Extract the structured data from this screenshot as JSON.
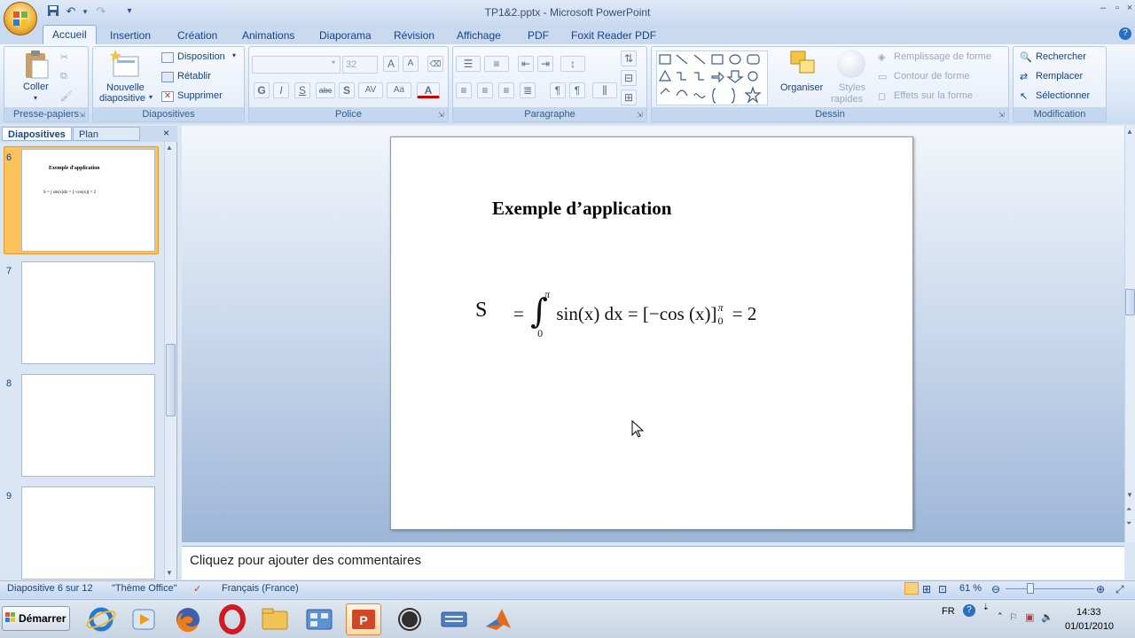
{
  "window": {
    "title": "TP1&2.pptx - Microsoft PowerPoint"
  },
  "tabs": [
    "Accueil",
    "Insertion",
    "Création",
    "Animations",
    "Diaporama",
    "Révision",
    "Affichage",
    "PDF",
    "Foxit Reader PDF"
  ],
  "ribbon": {
    "clipboard": {
      "paste": "Coller",
      "group": "Presse-papiers"
    },
    "slides": {
      "new_slide_1": "Nouvelle",
      "new_slide_2": "diapositive",
      "layout": "Disposition",
      "reset": "Rétablir",
      "delete": "Supprimer",
      "group": "Diapositives"
    },
    "font": {
      "size": "32",
      "group": "Police",
      "bold": "G",
      "italic": "I",
      "underline": "S",
      "strike": "abc",
      "shadow": "S",
      "spacing": "AV",
      "case": "Aa",
      "color": "A"
    },
    "paragraph": {
      "group": "Paragraphe"
    },
    "drawing": {
      "arrange": "Organiser",
      "styles_1": "Styles",
      "styles_2": "rapides",
      "fill": "Remplissage de forme",
      "outline": "Contour de forme",
      "effects": "Effets sur la forme",
      "group": "Dessin"
    },
    "editing": {
      "find": "Rechercher",
      "replace": "Remplacer",
      "select": "Sélectionner",
      "group": "Modification"
    }
  },
  "panel": {
    "tab_slides": "Diapositives",
    "tab_outline": "Plan",
    "thumbs": [
      {
        "num": "6",
        "title": "Exemple d'application",
        "eq": "S = ∫ sin(x)dx = [−cos(x)] = 2"
      },
      {
        "num": "7"
      },
      {
        "num": "8"
      },
      {
        "num": "9"
      }
    ]
  },
  "slide": {
    "title": "Exemple d’application",
    "s_label": "S",
    "eq_eq1": "=",
    "eq_int": "∫",
    "eq_upper": "π",
    "eq_lower": "0",
    "eq_body": "sin(x) dx = [−cos (x)]",
    "eq_sup": "π",
    "eq_sub": "0",
    "eq_result": "= 2"
  },
  "notes": {
    "placeholder": "Cliquez pour ajouter des commentaires"
  },
  "status": {
    "slide_info": "Diapositive 6 sur 12",
    "theme": "\"Thème Office\"",
    "language": "Français (France)",
    "zoom": "61 %"
  },
  "taskbar": {
    "start": "Démarrer",
    "lang": "FR",
    "time": "14:33",
    "date": "01/01/2010"
  }
}
